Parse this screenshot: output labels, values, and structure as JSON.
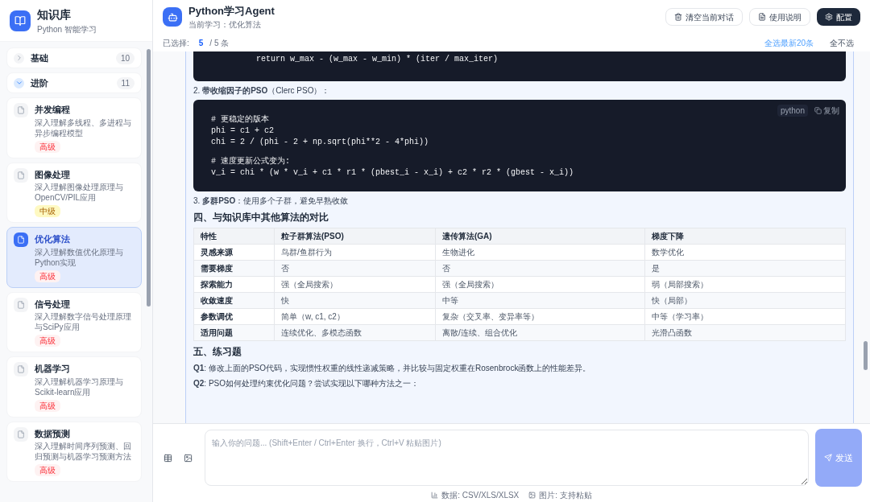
{
  "sidebar": {
    "title": "知识库",
    "subtitle": "Python 智能学习",
    "groups": [
      {
        "label": "基础",
        "count": "10",
        "expanded": false
      },
      {
        "label": "进阶",
        "count": "11",
        "expanded": true,
        "items": [
          {
            "title": "并发编程",
            "desc": "深入理解多线程、多进程与异步编程模型",
            "level": "高级",
            "kind": "hard",
            "selected": false
          },
          {
            "title": "图像处理",
            "desc": "深入理解图像处理原理与OpenCV/PIL应用",
            "level": "中级",
            "kind": "medium",
            "selected": false
          },
          {
            "title": "优化算法",
            "desc": "深入理解数值优化原理与Python实现",
            "level": "高级",
            "kind": "hard",
            "selected": true
          },
          {
            "title": "信号处理",
            "desc": "深入理解数字信号处理原理与SciPy应用",
            "level": "高级",
            "kind": "hard",
            "selected": false
          },
          {
            "title": "机器学习",
            "desc": "深入理解机器学习原理与Scikit-learn应用",
            "level": "高级",
            "kind": "hard",
            "selected": false
          },
          {
            "title": "数据预测",
            "desc": "深入理解时间序列预测、回归预测与机器学习预测方法",
            "level": "高级",
            "kind": "hard",
            "selected": false
          }
        ]
      }
    ]
  },
  "header": {
    "title": "Python学习Agent",
    "subtitle": "当前学习：优化算法",
    "buttons": [
      {
        "label": "清空当前对话",
        "kind": "clear"
      },
      {
        "label": "使用说明",
        "kind": "help"
      },
      {
        "label": "配置",
        "kind": "config"
      }
    ]
  },
  "selection": {
    "label": "已选择:",
    "selected": "5",
    "total": "/ 5 条",
    "select_recent": "全选最新20条",
    "select_none": "全不选"
  },
  "message": {
    "code1": [
      "        return w_max - (w_max - w_min) * (iter / max_iter)"
    ],
    "item2": {
      "text": "2. **带收缩因子的PSO**（Clerc PSO）："
    },
    "code2": {
      "lang": "python",
      "copy": "复制",
      "paragraphs": [
        [
          "# 更稳定的版本",
          "phi = c1 + c2",
          "chi = 2 / (phi - 2 + np.sqrt(phi**2 - 4*phi))"
        ],
        [
          "# 速度更新公式变为:",
          "v_i = chi * (w * v_i + c1 * r1 * (pbest_i - x_i) + c2 * r2 * (gbest - x_i))"
        ]
      ]
    },
    "item3": "3. **多群PSO**：使用多个子群，避免早熟收敛",
    "heading4": "四、与知识库中其他算法的对比",
    "table": {
      "columns": [
        "特性",
        "粒子群算法(PSO)",
        "遗传算法(GA)",
        "梯度下降"
      ],
      "rows": [
        [
          "灵感来源",
          "鸟群/鱼群行为",
          "生物进化",
          "数学优化"
        ],
        [
          "需要梯度",
          "否",
          "否",
          "是"
        ],
        [
          "探索能力",
          "强（全局搜索）",
          "强（全局搜索）",
          "弱（局部搜索）"
        ],
        [
          "收敛速度",
          "快",
          "中等",
          "快（局部）"
        ],
        [
          "参数调优",
          "简单（w, c1, c2）",
          "复杂（交叉率、变异率等）",
          "中等（学习率）"
        ],
        [
          "适用问题",
          "连续优化、多模态函数",
          "离散/连续、组合优化",
          "光滑凸函数"
        ]
      ]
    },
    "heading5": "五、练习题",
    "questions": [
      "**Q1**: 修改上面的PSO代码，实现惯性权重的线性递减策略，并比较与固定权重在Rosenbrock函数上的性能差异。",
      "**Q2**: PSO如何处理约束优化问题？尝试实现以下哪种方法之一："
    ]
  },
  "input": {
    "placeholder": "输入你的问题... (Shift+Enter / Ctrl+Enter 换行，Ctrl+V 粘贴图片)",
    "send": "发送",
    "hints": [
      "数据: CSV/XLS/XLSX",
      "图片: 支持粘贴"
    ]
  }
}
